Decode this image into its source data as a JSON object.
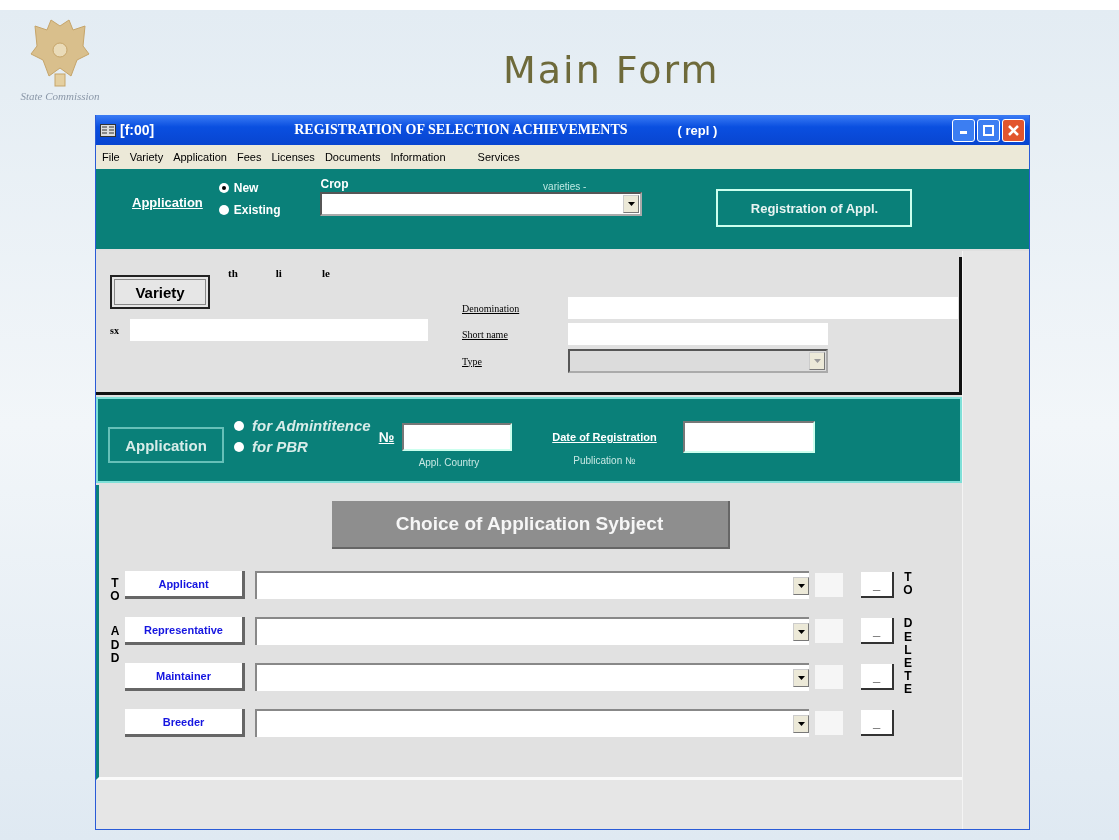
{
  "slide": {
    "title": "Main Form",
    "logo_caption": "State Commission"
  },
  "window": {
    "code": "[f:00]",
    "title": "REGISTRATION OF SELECTION ACHIEVEMENTS",
    "mode": "( repl )"
  },
  "menu": [
    "File",
    "Variety",
    "Application",
    "Fees",
    "Licenses",
    "Documents",
    "Information",
    "Services"
  ],
  "application_bar": {
    "link": "Application",
    "options": [
      {
        "label": "New",
        "selected": true
      },
      {
        "label": "Existing",
        "selected": false
      }
    ],
    "crop_label": "Crop",
    "crop_hint": "varieties -",
    "button": "Registration of Appl."
  },
  "variety_panel": {
    "button": "Variety",
    "column_labels": [
      "th",
      "li",
      "le"
    ],
    "code_label": "sx",
    "fields": [
      {
        "label": "Denomination",
        "kind": "long"
      },
      {
        "label": "Short name",
        "kind": "short"
      },
      {
        "label": "Type",
        "kind": "select"
      }
    ]
  },
  "application_panel": {
    "button": "Application",
    "options": [
      {
        "label": "for Admintitence",
        "selected": false
      },
      {
        "label": "for PBR",
        "selected": false
      }
    ],
    "number_label": "№",
    "number_sub": "Appl. Country",
    "date_label": "Date of Registration",
    "date_sub": "Publication №"
  },
  "subject_panel": {
    "choice_button": {
      "label": "Choice of Application Sybject",
      "disabled": true
    },
    "add_label": [
      "TO",
      "ADD"
    ],
    "delete_label": [
      "TO",
      "DELETE"
    ],
    "rows": [
      {
        "button": "Applicant",
        "delete": "_"
      },
      {
        "button": "Representative",
        "delete": "_"
      },
      {
        "button": "Maintainer",
        "delete": "_"
      },
      {
        "button": "Breeder",
        "delete": "_"
      }
    ]
  }
}
